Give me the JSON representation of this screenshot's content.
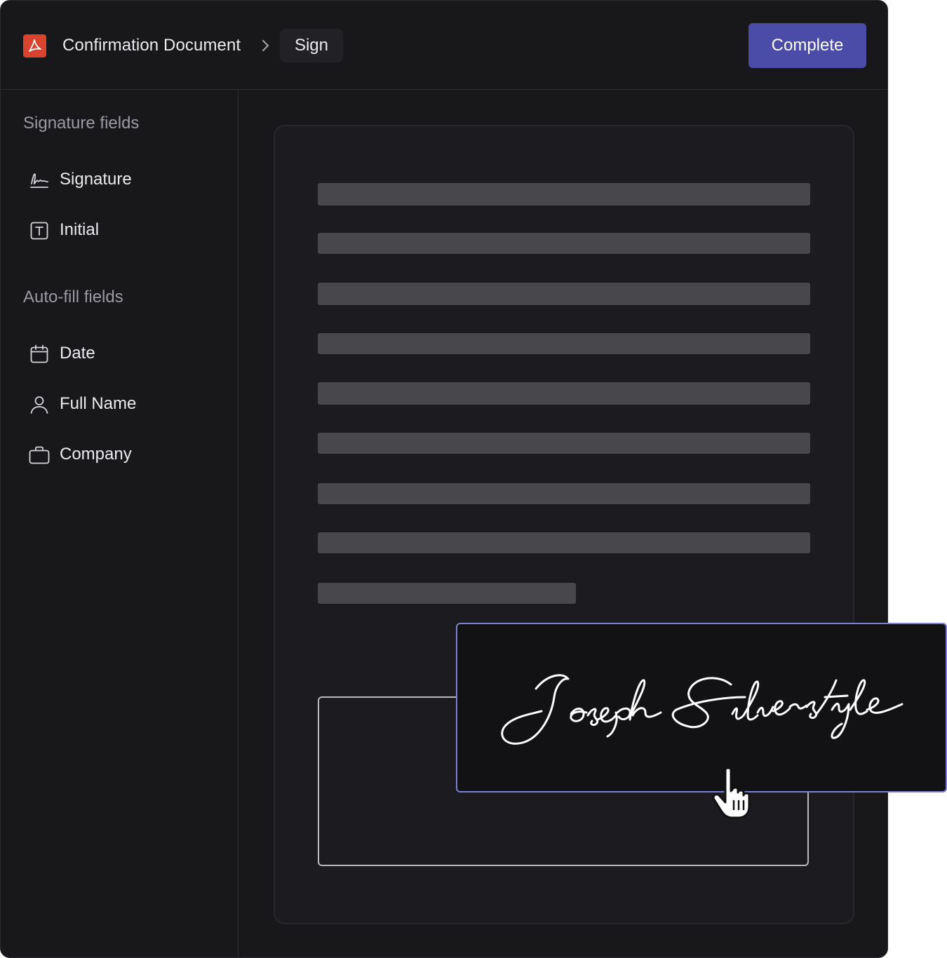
{
  "header": {
    "app_icon": "pdf-icon",
    "document_title": "Confirmation Document",
    "breadcrumb_separator_icon": "chevron-right-icon",
    "current_step": "Sign",
    "complete_label": "Complete"
  },
  "sidebar": {
    "signature_section_title": "Signature fields",
    "signature_fields": [
      {
        "label": "Signature",
        "icon": "signature-icon"
      },
      {
        "label": "Initial",
        "icon": "text-box-icon"
      }
    ],
    "autofill_section_title": "Auto-fill fields",
    "autofill_fields": [
      {
        "label": "Date",
        "icon": "calendar-icon"
      },
      {
        "label": "Full Name",
        "icon": "user-icon"
      },
      {
        "label": "Company",
        "icon": "briefcase-icon"
      }
    ]
  },
  "signature_popup": {
    "signature_text": "Joseph Silverstyle",
    "cursor_icon": "hand-pointer-icon"
  },
  "colors": {
    "background": "#18181b",
    "accent": "#4b4ca8",
    "popup_border": "#7e7fd9",
    "pdf_red": "#d9442f",
    "placeholder_line": "#48484c"
  }
}
